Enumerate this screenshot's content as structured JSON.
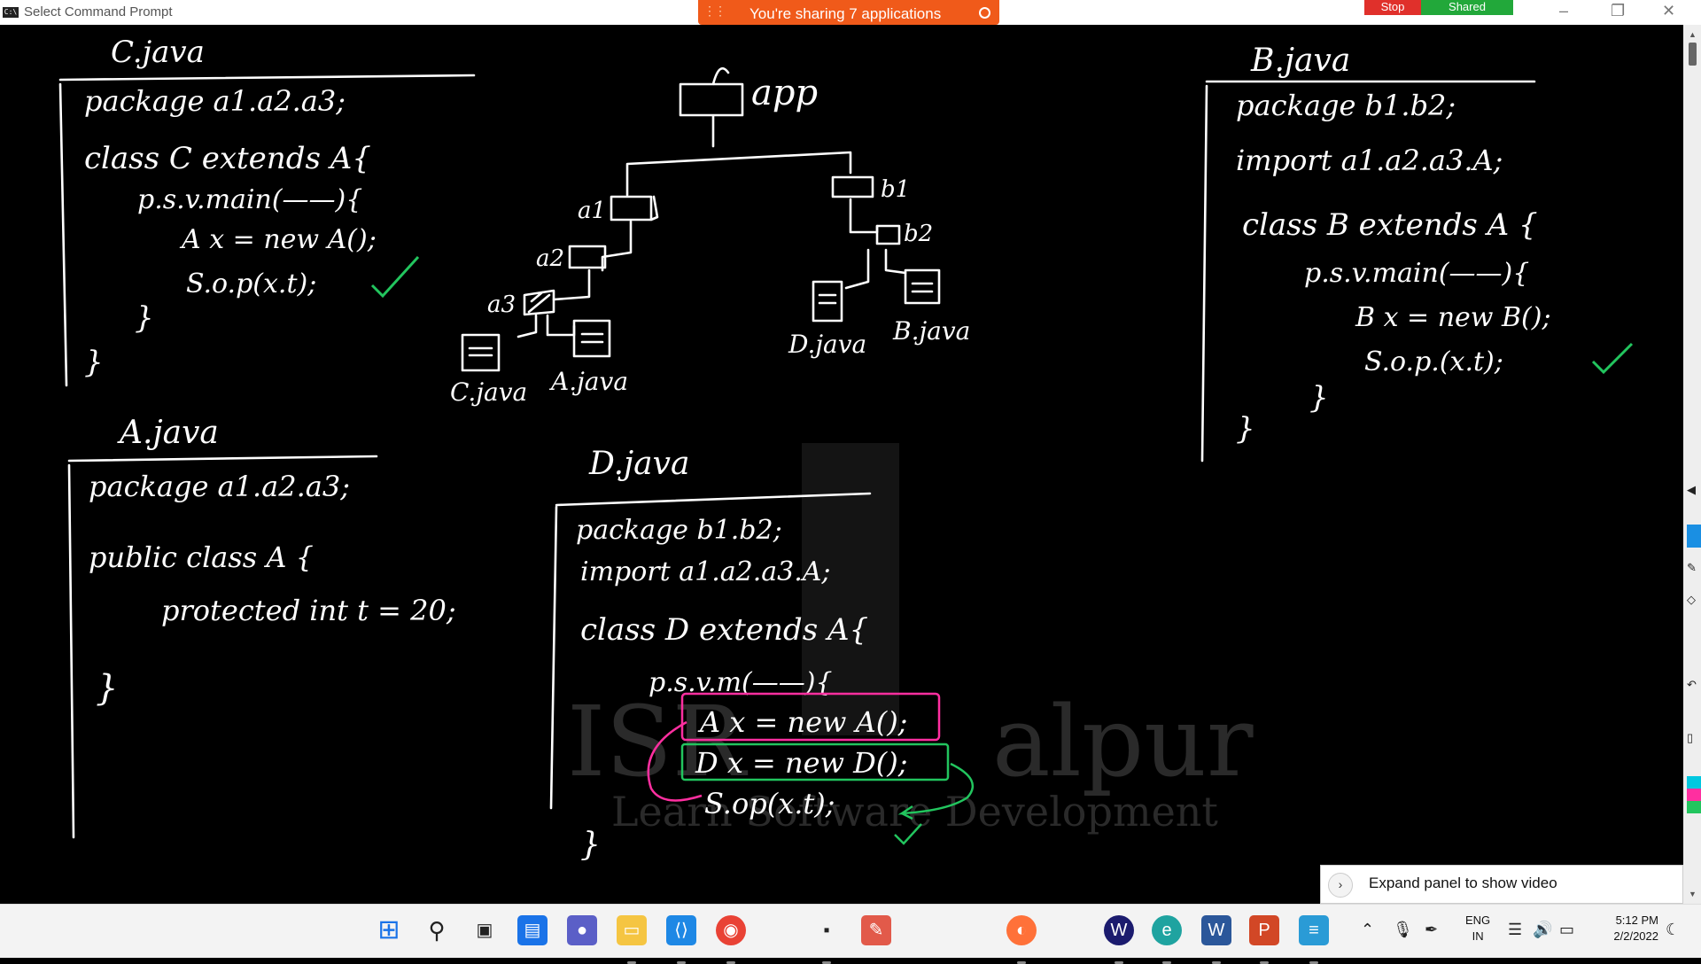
{
  "window": {
    "title": "Select Command Prompt",
    "icon_label": "C:\\"
  },
  "share_banner": {
    "text": "You're sharing 7 applications"
  },
  "meeting_controls": {
    "stop_label": "Stop",
    "shared_label": "Shared"
  },
  "window_controls": {
    "minimize": "–",
    "restore": "❐",
    "close": "✕"
  },
  "whiteboard": {
    "watermark": {
      "line1": "ISR",
      "line1b": "alpur",
      "line2": "Learn Software Development"
    },
    "c_java": {
      "filename": "C.java",
      "lines": [
        "package a1.a2.a3;",
        "class C extends A{",
        "p.s.v.main(——){",
        "A x = new A();",
        "S.o.p(x.t);",
        "}",
        "}"
      ]
    },
    "a_java": {
      "filename": "A.java",
      "lines": [
        "package a1.a2.a3;",
        "public class A {",
        "protected int t = 20;",
        "}"
      ]
    },
    "b_java": {
      "filename": "B.java",
      "lines": [
        "package b1.b2;",
        "import a1.a2.a3.A;",
        "class B extends A {",
        "p.s.v.main(——){",
        "B x = new B();",
        "S.o.p.(x.t);",
        "}",
        "}"
      ]
    },
    "d_java": {
      "filename": "D.java",
      "lines": [
        "package b1.b2;",
        "import a1.a2.a3.A;",
        "class D extends A{",
        "p.s.v.m(——){",
        "A x = new A();",
        "D x = new D();",
        "S.op(x.t);",
        "}"
      ]
    },
    "tree": {
      "root": "app",
      "folders": [
        "a1",
        "a2",
        "a3",
        "b1",
        "b2"
      ],
      "files": [
        "C.java",
        "A.java",
        "D.java",
        "B.java"
      ]
    },
    "colors": {
      "ink": "#ffffff",
      "check": "#22c55e",
      "highlight_pink": "#ff2fa0",
      "highlight_green": "#22c55e"
    }
  },
  "expand_panel": {
    "text": "Expand panel to show video"
  },
  "taskbar": {
    "icons": [
      "windows-start-icon",
      "search-icon",
      "task-view-icon",
      "widgets-icon",
      "teams-chat-icon",
      "file-explorer-icon",
      "vscode-icon",
      "chrome-icon",
      "cmd-icon",
      "paint-icon",
      "firefox-icon",
      "webex-icon",
      "edge-icon",
      "word-icon",
      "powerpoint-icon",
      "notepad-icon"
    ],
    "language": {
      "line1": "ENG",
      "line2": "IN"
    },
    "clock": {
      "time": "5:12 PM",
      "date": "2/2/2022"
    }
  }
}
